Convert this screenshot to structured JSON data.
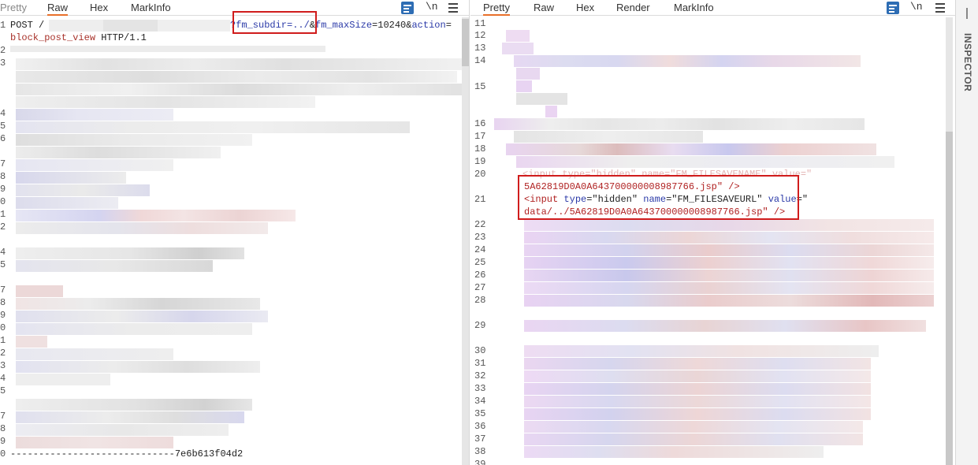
{
  "left": {
    "tabs": [
      "Pretty",
      "Raw",
      "Hex",
      "MarkInfo"
    ],
    "active_tab": "Raw",
    "newline_toggle": "\\n",
    "line_numbers": [
      "1",
      "",
      "2",
      "3",
      "",
      "",
      "",
      "4",
      "5",
      "6",
      "",
      "7",
      "8",
      "9",
      "0",
      "1",
      "2",
      "3",
      "4",
      "5",
      "6",
      "7",
      "8",
      "9",
      "0",
      "1",
      "2",
      "3",
      "4",
      "5",
      "6",
      "7",
      "8",
      "9",
      "0"
    ],
    "line1_part1": "POST /",
    "line1_query_highlight": "?fm_subdir=../",
    "line1_amp": "&",
    "line1_part2": "fm_maxSize",
    "line1_eq": "=10240&",
    "line1_part3": "action",
    "line1_eq2": "=",
    "line1_cont_value": "block_post_view",
    "line1_cont_proto": " HTTP/1.1",
    "boundary": "-----------------------------7e6b613f04d2"
  },
  "right": {
    "tabs": [
      "Pretty",
      "Raw",
      "Hex",
      "Render",
      "MarkInfo"
    ],
    "active_tab": "Pretty",
    "newline_toggle": "\\n",
    "line_numbers": [
      "11",
      "12",
      "13",
      "14",
      "15",
      "16",
      "17",
      "18",
      "19",
      "20",
      "21",
      "22",
      "23",
      "24",
      "25",
      "26",
      "27",
      "28",
      "29",
      "30",
      "31",
      "32",
      "33",
      "34",
      "35",
      "36",
      "37",
      "38",
      "39"
    ],
    "line20_value": "5A62819D0A0A643700000008987766.jsp\" />",
    "line21_a": "<input ",
    "line21_type_attr": "type",
    "line21_type_val": "=\"hidden\" ",
    "line21_name_attr": "name",
    "line21_name_val": "=\"FM_FILESAVEURL\" ",
    "line21_value_attr": "value",
    "line21_value_eq": "=\"",
    "line21_cont": "data/../5A62819D0A0A643700000008987766.jsp\" />"
  },
  "inspector": {
    "label": "INSPECTOR"
  },
  "colors": {
    "accent_tab": "#e8702a",
    "highlight_box": "#d01c1c",
    "wrap_button": "#2e6db4"
  }
}
